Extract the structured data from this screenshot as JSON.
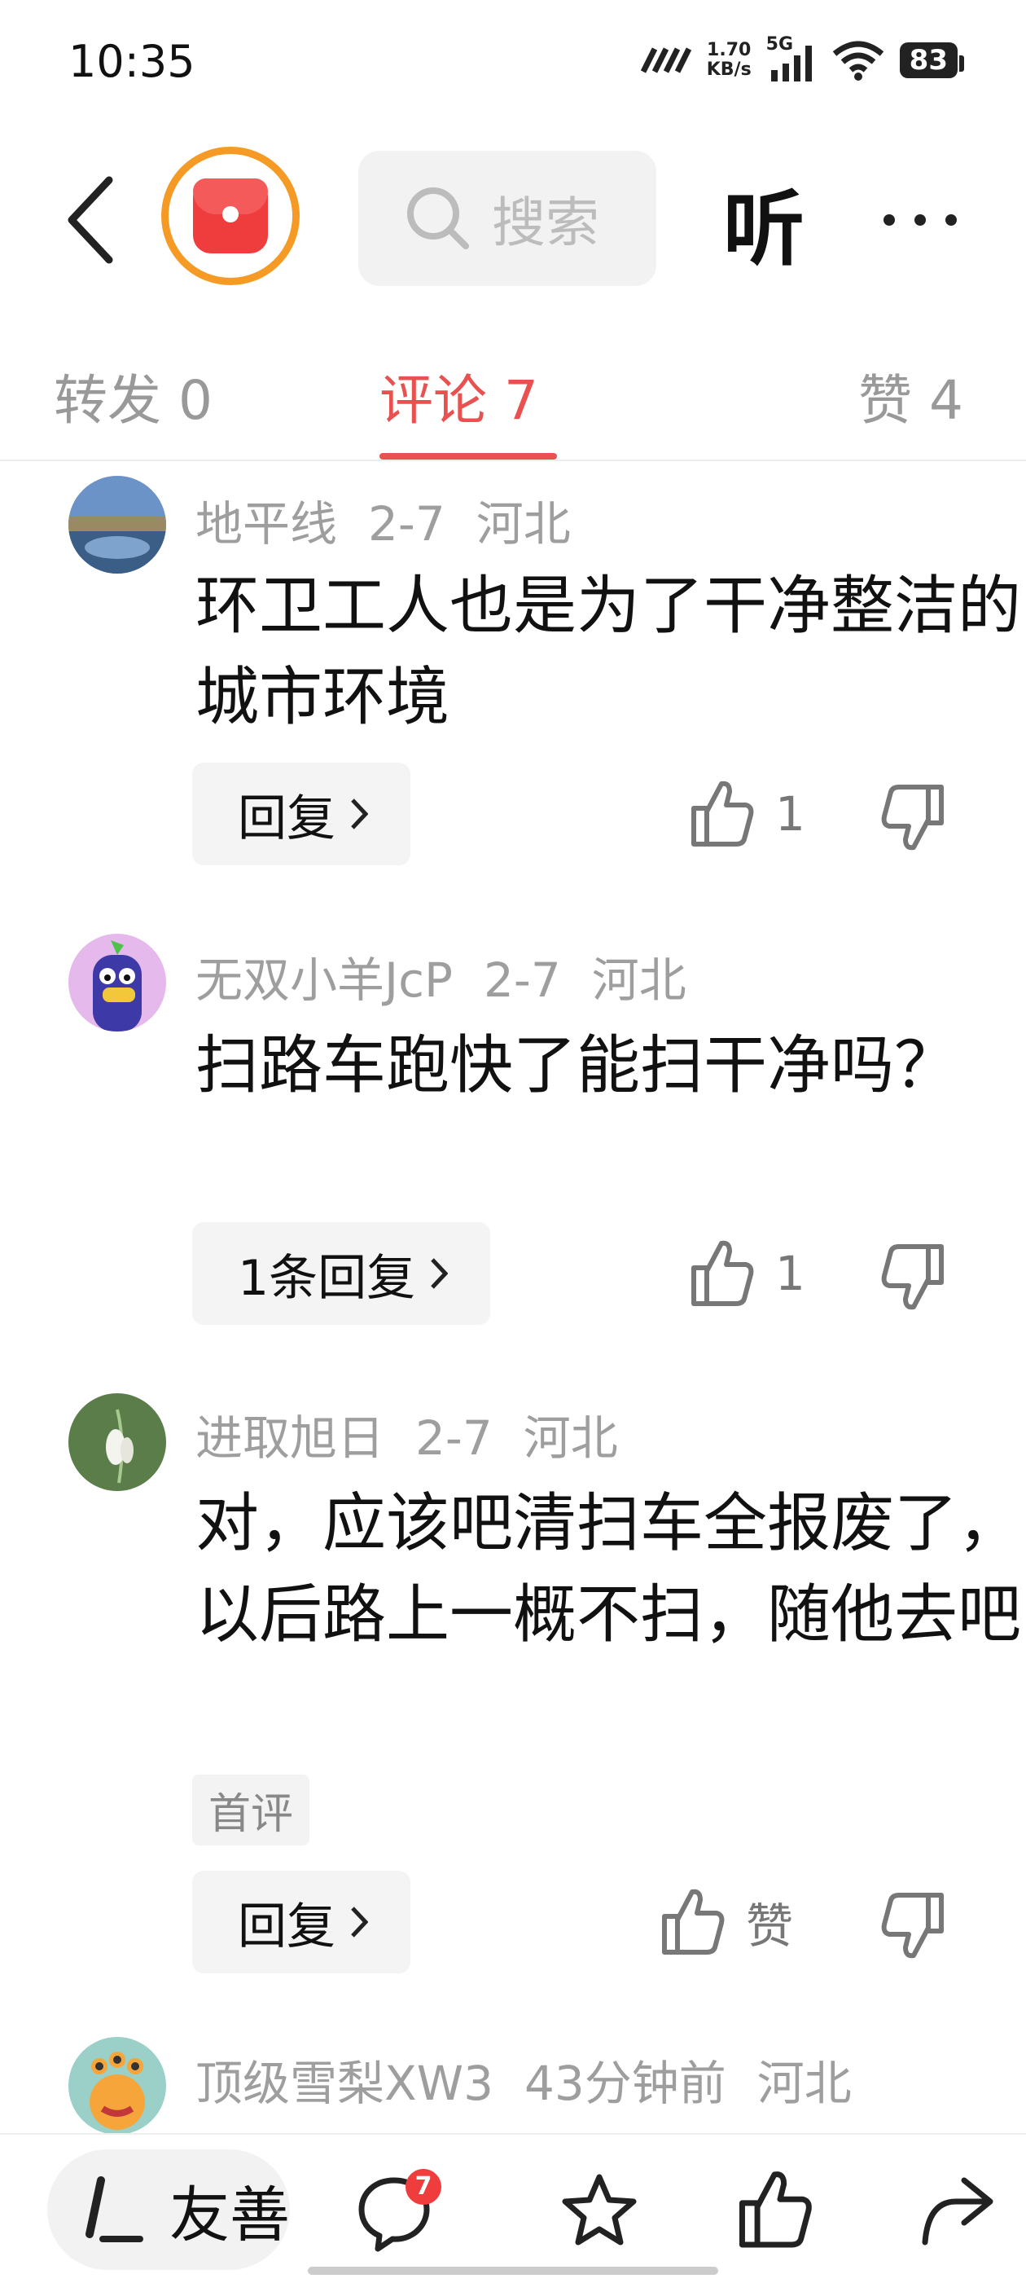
{
  "status_bar": {
    "time": "10:35",
    "net_speed_value": "1.70",
    "net_speed_unit": "KB/s",
    "signal_label": "5G",
    "battery": "83"
  },
  "header": {
    "search_placeholder": "搜索",
    "listen_label": "听"
  },
  "tabs": [
    {
      "label": "转发 0"
    },
    {
      "label": "评论 7"
    },
    {
      "label": "赞 4"
    }
  ],
  "comments": [
    {
      "username": "地平线",
      "date": "2-7",
      "location": "河北",
      "text": "环卫工人也是为了干净整洁的城市环境",
      "reply_label": "回复",
      "like_value": "1"
    },
    {
      "username": "无双小羊JcP",
      "date": "2-7",
      "location": "河北",
      "text": "扫路车跑快了能扫干净吗？",
      "reply_label": "1条回复",
      "like_value": "1"
    },
    {
      "username": "进取旭日",
      "date": "2-7",
      "location": "河北",
      "text": "对，应该吧清扫车全报废了，以后路上一概不扫，随他去吧",
      "badge": "首评",
      "reply_label": "回复",
      "like_value": "赞"
    },
    {
      "username": "顶级雪梨XW3",
      "date": "43分钟前",
      "location": "河北"
    }
  ],
  "bottom_bar": {
    "compose_label": "友善",
    "comment_badge": "7"
  }
}
